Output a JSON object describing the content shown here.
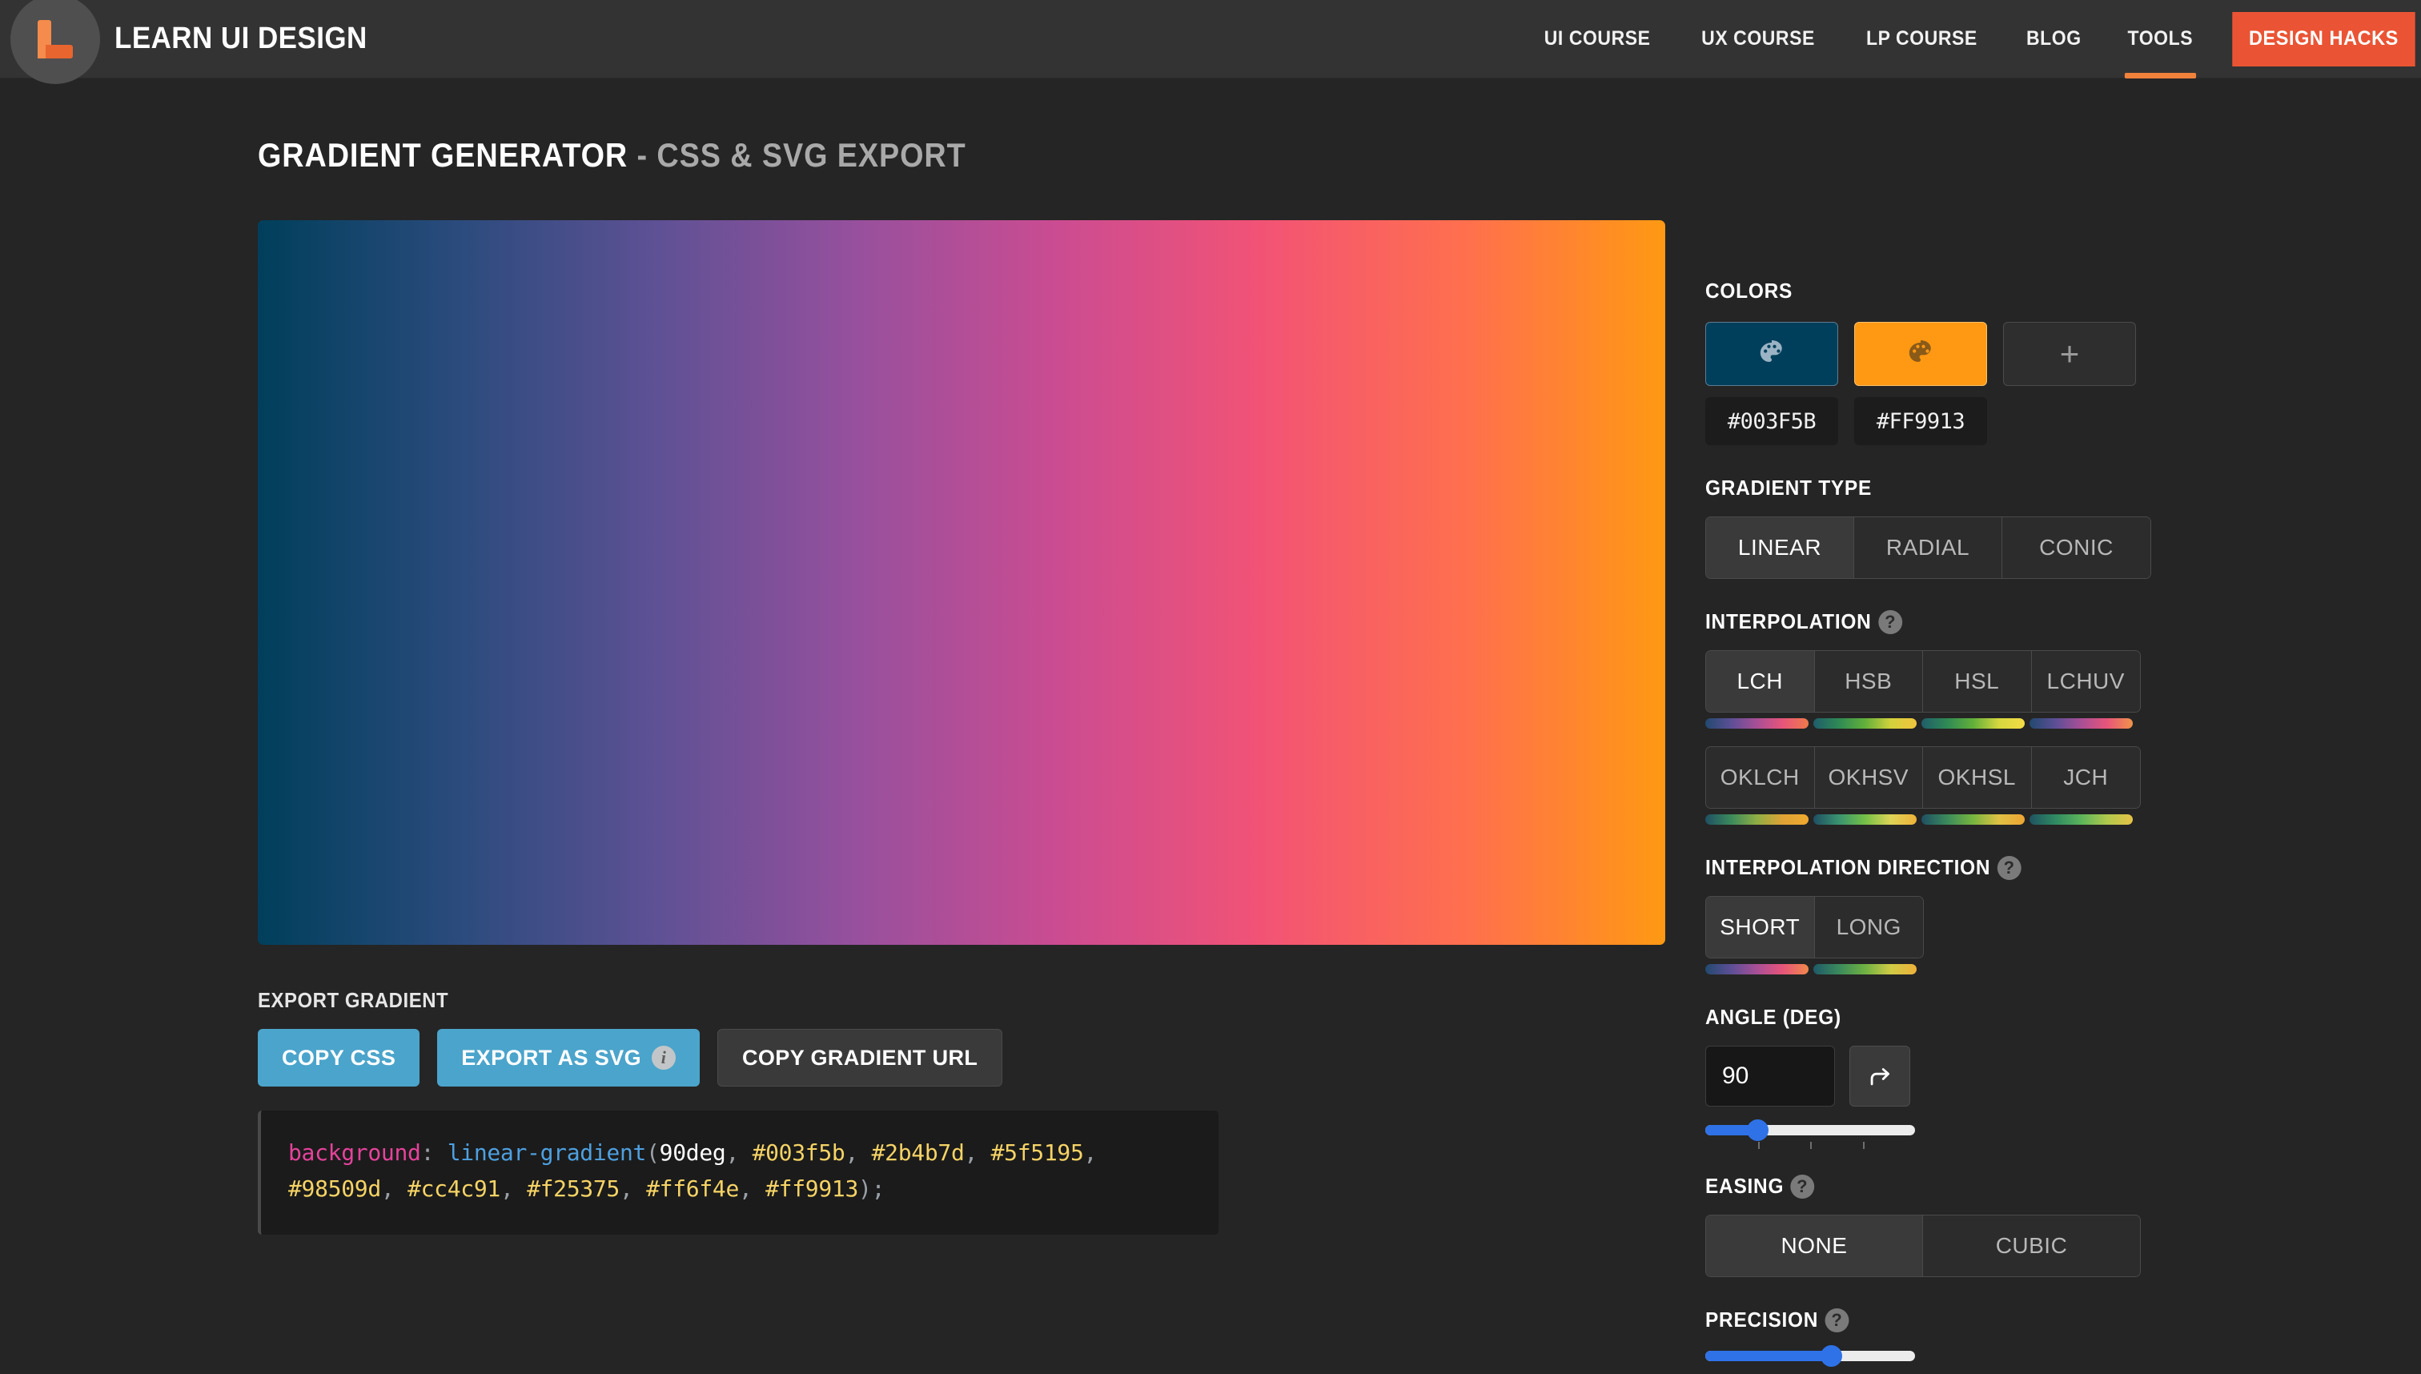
{
  "header": {
    "brand": "LEARN UI DESIGN",
    "logo_icon": "learn-ui-design-logo",
    "nav": [
      {
        "label": "UI COURSE",
        "active": false
      },
      {
        "label": "UX COURSE",
        "active": false
      },
      {
        "label": "LP COURSE",
        "active": false
      },
      {
        "label": "BLOG",
        "active": false
      },
      {
        "label": "TOOLS",
        "active": true
      }
    ],
    "cta": "DESIGN HACKS",
    "cta_color": "#ea5434",
    "accent_color": "#f0823c"
  },
  "main": {
    "title_primary": "GRADIENT GENERATOR",
    "title_separator": " - ",
    "title_secondary": "CSS & SVG EXPORT",
    "preview": {
      "name": "gradient-preview",
      "css": "linear-gradient(90deg, #003f5b, #2b4b7d, #5f5195, #98509d, #cc4c91, #f25375, #ff6f4e, #ff9913)"
    },
    "export": {
      "label": "EXPORT GRADIENT",
      "buttons": [
        {
          "label": "COPY CSS",
          "style": "primary",
          "info": false
        },
        {
          "label": "EXPORT AS SVG",
          "style": "primary",
          "info": true
        },
        {
          "label": "COPY GRADIENT URL",
          "style": "ghost",
          "info": false
        }
      ],
      "primary_color": "#4ba4cb"
    },
    "code": {
      "property": "background",
      "colon": ":",
      "function": "linear-gradient",
      "open_paren": "(",
      "angle": "90deg",
      "stops": [
        "#003f5b",
        "#2b4b7d",
        "#5f5195",
        "#98509d",
        "#cc4c91",
        "#f25375",
        "#ff6f4e",
        "#ff9913"
      ],
      "close": ");",
      "full_text": "background: linear-gradient(90deg, #003f5b, #2b4b7d, #5f5195, #98509d, #cc4c91, #f25375, #ff6f4e, #ff9913);"
    }
  },
  "sidebar": {
    "colors": {
      "label": "COLORS",
      "swatches": [
        {
          "hex": "#003F5B",
          "icon": "palette-icon",
          "selected": false
        },
        {
          "hex": "#FF9913",
          "icon": "palette-icon",
          "selected": false
        }
      ],
      "add_label": "+"
    },
    "gradient_type": {
      "label": "GRADIENT TYPE",
      "options": [
        "LINEAR",
        "RADIAL",
        "CONIC"
      ],
      "selected": "LINEAR"
    },
    "interpolation": {
      "label": "INTERPOLATION",
      "help": "?",
      "row1": [
        "LCH",
        "HSB",
        "HSL",
        "LCHUV"
      ],
      "row2": [
        "OKLCH",
        "OKHSV",
        "OKHSL",
        "JCH"
      ],
      "selected": "LCH",
      "previews_row1": [
        "linear-gradient(90deg,#22496f,#5c4f96,#a84f96,#e7557a,#f07a4a)",
        "linear-gradient(90deg,#1f5d6b,#2f8a54,#62b03a,#d2d13c,#f0c53d)",
        "linear-gradient(90deg,#1f5d6b,#2f8a54,#62b03a,#d6d73f,#f4dc45)",
        "linear-gradient(90deg,#22496f,#5c4f96,#a84f96,#e7557a,#f0934a)"
      ],
      "previews_row2": [
        "linear-gradient(90deg,#1f4f63,#3b8a5c,#8fae44,#e0a335,#efa92f)",
        "linear-gradient(90deg,#1f4f63,#3a9470,#74c046,#ddd457,#eeb13a)",
        "linear-gradient(90deg,#1f4f63,#3b8a5c,#77b63f,#dfc144,#eda533)",
        "linear-gradient(90deg,#1f5361,#2f8a62,#5cb45a,#b0c94c,#e6c248)"
      ]
    },
    "interpolation_direction": {
      "label": "INTERPOLATION DIRECTION",
      "help": "?",
      "options": [
        "SHORT",
        "LONG"
      ],
      "selected": "SHORT",
      "previews": [
        "linear-gradient(90deg,#22496f,#5c4f96,#a84f96,#e7557a,#f0884a)",
        "linear-gradient(90deg,#1f5a68,#3b8a5c,#6eb142,#d0cb45,#edb13a)"
      ]
    },
    "angle": {
      "label": "ANGLE (DEG)",
      "value": "90",
      "placeholder": "0",
      "rotate_icon": "rotate-arrow-icon",
      "slider_percent": 25,
      "ticks_percent": [
        25,
        50,
        75
      ]
    },
    "easing": {
      "label": "EASING",
      "help": "?",
      "options": [
        "NONE",
        "CUBIC"
      ],
      "selected": "NONE"
    },
    "precision": {
      "label": "PRECISION",
      "help": "?",
      "slider_percent": 60
    },
    "slider_color": "#2f72e8"
  }
}
